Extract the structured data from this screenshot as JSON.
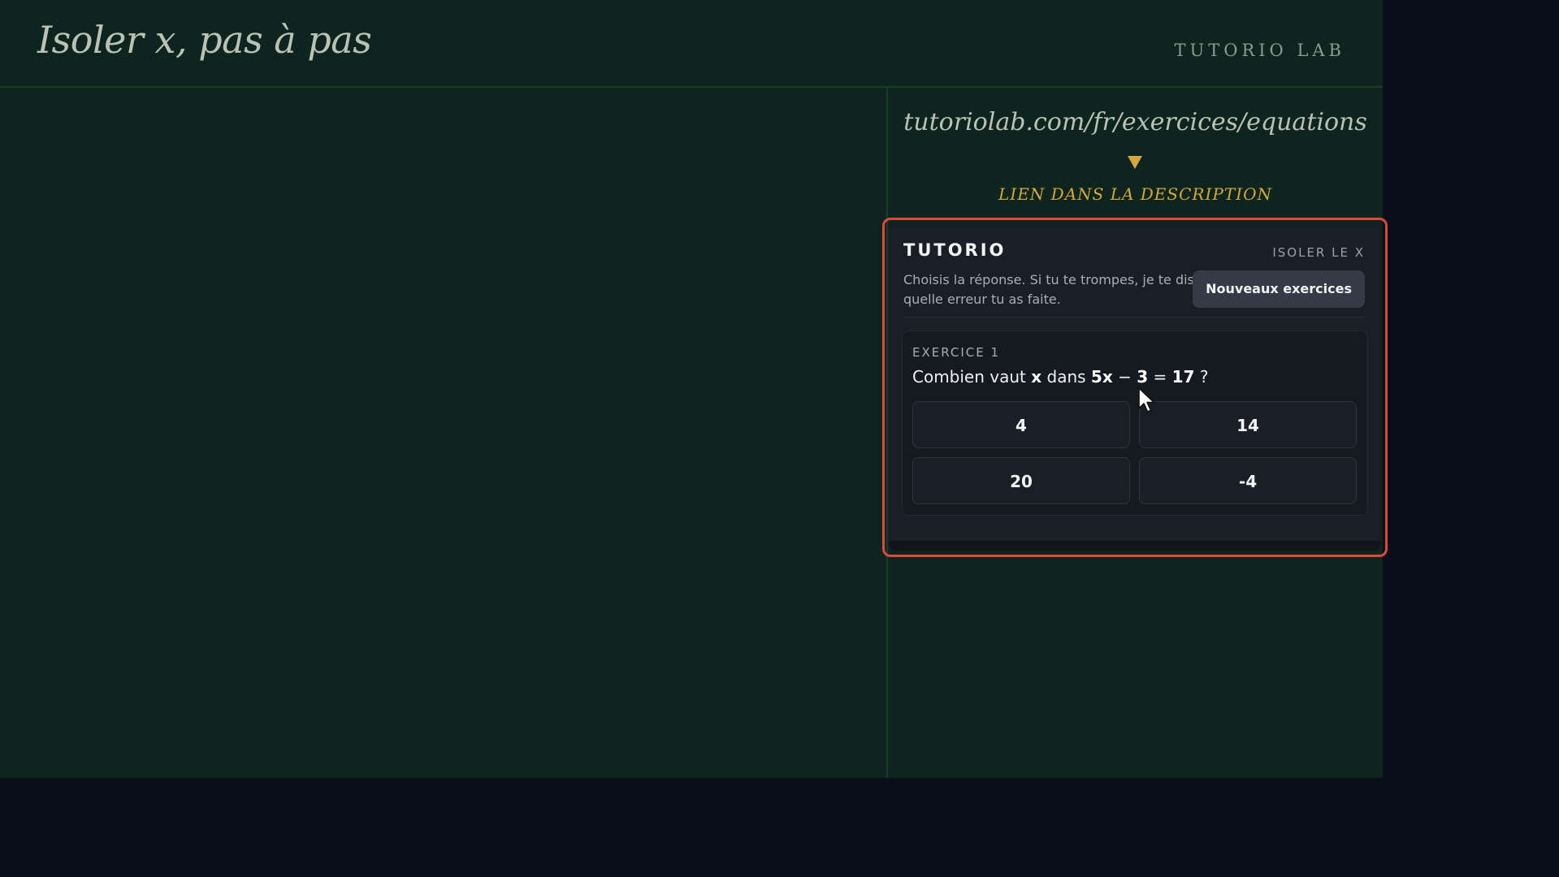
{
  "header": {
    "title": "Isoler x, pas à pas",
    "brand": "TUTORIO LAB"
  },
  "promo": {
    "url": "tutoriolab.com/fr/exercices/equations",
    "note": "LIEN DANS LA DESCRIPTION"
  },
  "widget": {
    "brand": "TUTORIO",
    "topic": "ISOLER LE X",
    "description": "Choisis la réponse. Si tu te trompes, je te dis quelle erreur tu as faite.",
    "new_button": "Nouveaux exercices",
    "exercise": {
      "label": "EXERCICE 1",
      "question_prefix": "Combien vaut",
      "variable": "x",
      "question_mid": "dans",
      "equation": {
        "lhs": "5x",
        "op": "−",
        "constant": "3",
        "equals": "=",
        "rhs": "17"
      },
      "question_suffix": "?",
      "answers": [
        "4",
        "14",
        "20",
        "-4"
      ]
    }
  },
  "colors": {
    "stage_background": "#0e241e",
    "outer_background": "#0a0e1a",
    "accent_gold": "#d4a83a",
    "highlight_red": "#e0483b",
    "widget_background": "#1a1e26"
  },
  "icons": {
    "promo_arrow": "triangle-down-icon",
    "pointer": "mouse-cursor-icon"
  }
}
